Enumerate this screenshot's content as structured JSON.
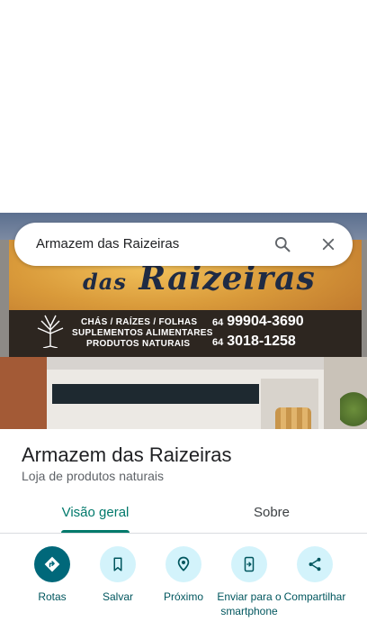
{
  "search": {
    "query": "Armazem das Raizeiras"
  },
  "photo": {
    "sign_title_small": "das",
    "sign_title_large": "Raizeiras",
    "sign_line_1": "CHÁS / RAÍZES / FOLHAS",
    "sign_line_2": "SUPLEMENTOS ALIMENTARES",
    "sign_line_3": "PRODUTOS NATURAIS",
    "phone_1_ddd": "64",
    "phone_1": "99904-3690",
    "phone_2_ddd": "64",
    "phone_2": "3018-1258"
  },
  "place": {
    "name": "Armazem das Raizeiras",
    "category": "Loja de produtos naturais"
  },
  "tabs": [
    {
      "label": "Visão geral",
      "active": true
    },
    {
      "label": "Sobre",
      "active": false
    }
  ],
  "actions": [
    {
      "label": "Rotas",
      "icon": "directions-icon"
    },
    {
      "label": "Salvar",
      "icon": "bookmark-icon"
    },
    {
      "label": "Próximo",
      "icon": "nearby-icon"
    },
    {
      "label": "Enviar para o smartphone",
      "icon": "send-to-phone-icon"
    },
    {
      "label": "Compartilhar",
      "icon": "share-icon"
    }
  ],
  "colors": {
    "accent": "#00796b",
    "action_circle": "#d3f3fb",
    "action_primary": "#00687a"
  }
}
